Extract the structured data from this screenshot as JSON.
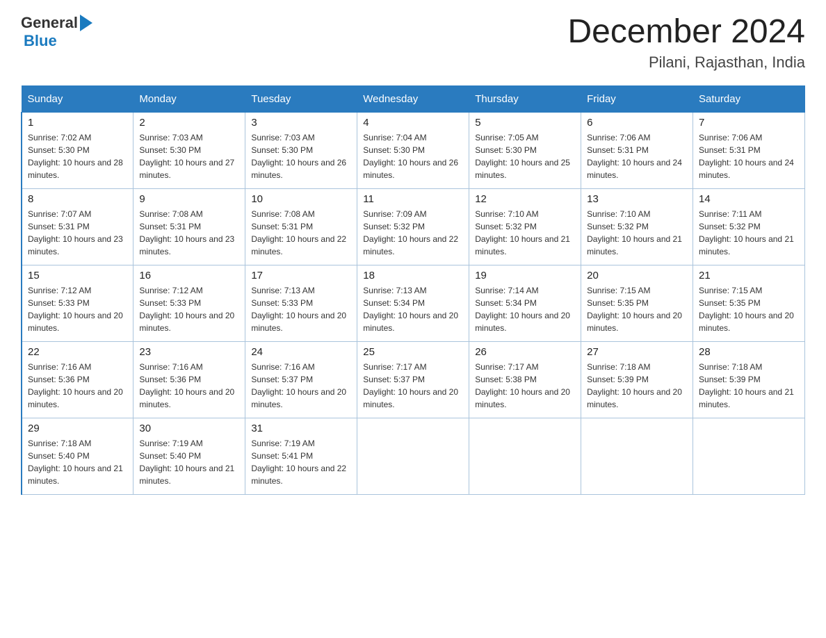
{
  "header": {
    "logo_general": "General",
    "logo_blue": "Blue",
    "month_title": "December 2024",
    "location": "Pilani, Rajasthan, India"
  },
  "calendar": {
    "days_of_week": [
      "Sunday",
      "Monday",
      "Tuesday",
      "Wednesday",
      "Thursday",
      "Friday",
      "Saturday"
    ],
    "weeks": [
      [
        {
          "day": "1",
          "sunrise": "7:02 AM",
          "sunset": "5:30 PM",
          "daylight": "10 hours and 28 minutes."
        },
        {
          "day": "2",
          "sunrise": "7:03 AM",
          "sunset": "5:30 PM",
          "daylight": "10 hours and 27 minutes."
        },
        {
          "day": "3",
          "sunrise": "7:03 AM",
          "sunset": "5:30 PM",
          "daylight": "10 hours and 26 minutes."
        },
        {
          "day": "4",
          "sunrise": "7:04 AM",
          "sunset": "5:30 PM",
          "daylight": "10 hours and 26 minutes."
        },
        {
          "day": "5",
          "sunrise": "7:05 AM",
          "sunset": "5:30 PM",
          "daylight": "10 hours and 25 minutes."
        },
        {
          "day": "6",
          "sunrise": "7:06 AM",
          "sunset": "5:31 PM",
          "daylight": "10 hours and 24 minutes."
        },
        {
          "day": "7",
          "sunrise": "7:06 AM",
          "sunset": "5:31 PM",
          "daylight": "10 hours and 24 minutes."
        }
      ],
      [
        {
          "day": "8",
          "sunrise": "7:07 AM",
          "sunset": "5:31 PM",
          "daylight": "10 hours and 23 minutes."
        },
        {
          "day": "9",
          "sunrise": "7:08 AM",
          "sunset": "5:31 PM",
          "daylight": "10 hours and 23 minutes."
        },
        {
          "day": "10",
          "sunrise": "7:08 AM",
          "sunset": "5:31 PM",
          "daylight": "10 hours and 22 minutes."
        },
        {
          "day": "11",
          "sunrise": "7:09 AM",
          "sunset": "5:32 PM",
          "daylight": "10 hours and 22 minutes."
        },
        {
          "day": "12",
          "sunrise": "7:10 AM",
          "sunset": "5:32 PM",
          "daylight": "10 hours and 21 minutes."
        },
        {
          "day": "13",
          "sunrise": "7:10 AM",
          "sunset": "5:32 PM",
          "daylight": "10 hours and 21 minutes."
        },
        {
          "day": "14",
          "sunrise": "7:11 AM",
          "sunset": "5:32 PM",
          "daylight": "10 hours and 21 minutes."
        }
      ],
      [
        {
          "day": "15",
          "sunrise": "7:12 AM",
          "sunset": "5:33 PM",
          "daylight": "10 hours and 20 minutes."
        },
        {
          "day": "16",
          "sunrise": "7:12 AM",
          "sunset": "5:33 PM",
          "daylight": "10 hours and 20 minutes."
        },
        {
          "day": "17",
          "sunrise": "7:13 AM",
          "sunset": "5:33 PM",
          "daylight": "10 hours and 20 minutes."
        },
        {
          "day": "18",
          "sunrise": "7:13 AM",
          "sunset": "5:34 PM",
          "daylight": "10 hours and 20 minutes."
        },
        {
          "day": "19",
          "sunrise": "7:14 AM",
          "sunset": "5:34 PM",
          "daylight": "10 hours and 20 minutes."
        },
        {
          "day": "20",
          "sunrise": "7:15 AM",
          "sunset": "5:35 PM",
          "daylight": "10 hours and 20 minutes."
        },
        {
          "day": "21",
          "sunrise": "7:15 AM",
          "sunset": "5:35 PM",
          "daylight": "10 hours and 20 minutes."
        }
      ],
      [
        {
          "day": "22",
          "sunrise": "7:16 AM",
          "sunset": "5:36 PM",
          "daylight": "10 hours and 20 minutes."
        },
        {
          "day": "23",
          "sunrise": "7:16 AM",
          "sunset": "5:36 PM",
          "daylight": "10 hours and 20 minutes."
        },
        {
          "day": "24",
          "sunrise": "7:16 AM",
          "sunset": "5:37 PM",
          "daylight": "10 hours and 20 minutes."
        },
        {
          "day": "25",
          "sunrise": "7:17 AM",
          "sunset": "5:37 PM",
          "daylight": "10 hours and 20 minutes."
        },
        {
          "day": "26",
          "sunrise": "7:17 AM",
          "sunset": "5:38 PM",
          "daylight": "10 hours and 20 minutes."
        },
        {
          "day": "27",
          "sunrise": "7:18 AM",
          "sunset": "5:39 PM",
          "daylight": "10 hours and 20 minutes."
        },
        {
          "day": "28",
          "sunrise": "7:18 AM",
          "sunset": "5:39 PM",
          "daylight": "10 hours and 21 minutes."
        }
      ],
      [
        {
          "day": "29",
          "sunrise": "7:18 AM",
          "sunset": "5:40 PM",
          "daylight": "10 hours and 21 minutes."
        },
        {
          "day": "30",
          "sunrise": "7:19 AM",
          "sunset": "5:40 PM",
          "daylight": "10 hours and 21 minutes."
        },
        {
          "day": "31",
          "sunrise": "7:19 AM",
          "sunset": "5:41 PM",
          "daylight": "10 hours and 22 minutes."
        },
        null,
        null,
        null,
        null
      ]
    ]
  }
}
